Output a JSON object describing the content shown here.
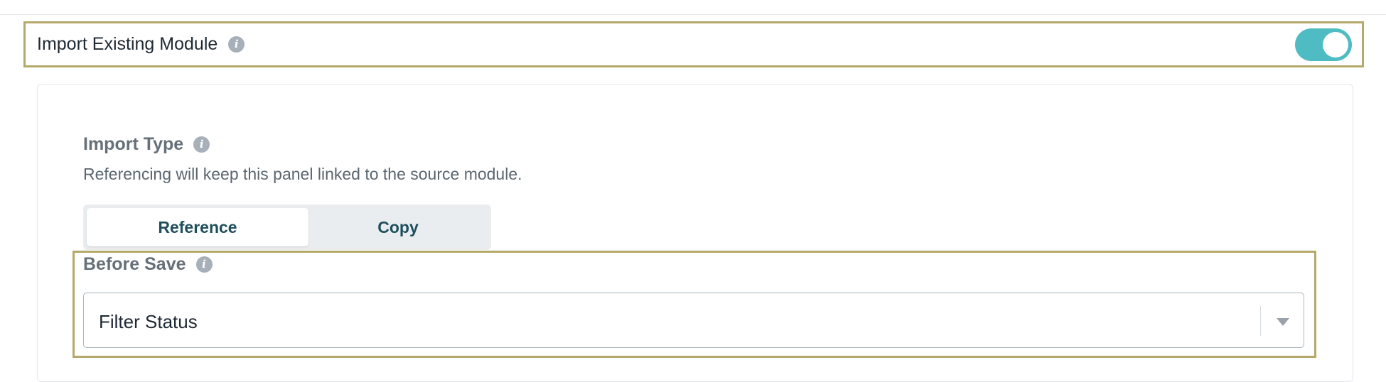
{
  "import_existing": {
    "label": "Import Existing Module",
    "info_icon": "i",
    "toggle_on": true,
    "toggle_color": "#4fbcc4"
  },
  "import_type": {
    "title": "Import Type",
    "info_icon": "i",
    "description": "Referencing will keep this panel linked to the source module.",
    "options": [
      "Reference",
      "Copy"
    ],
    "selected": "Reference"
  },
  "before_save": {
    "title": "Before Save",
    "info_icon": "i",
    "selected_value": "Filter Status"
  },
  "highlight_color": "#b5a86a"
}
